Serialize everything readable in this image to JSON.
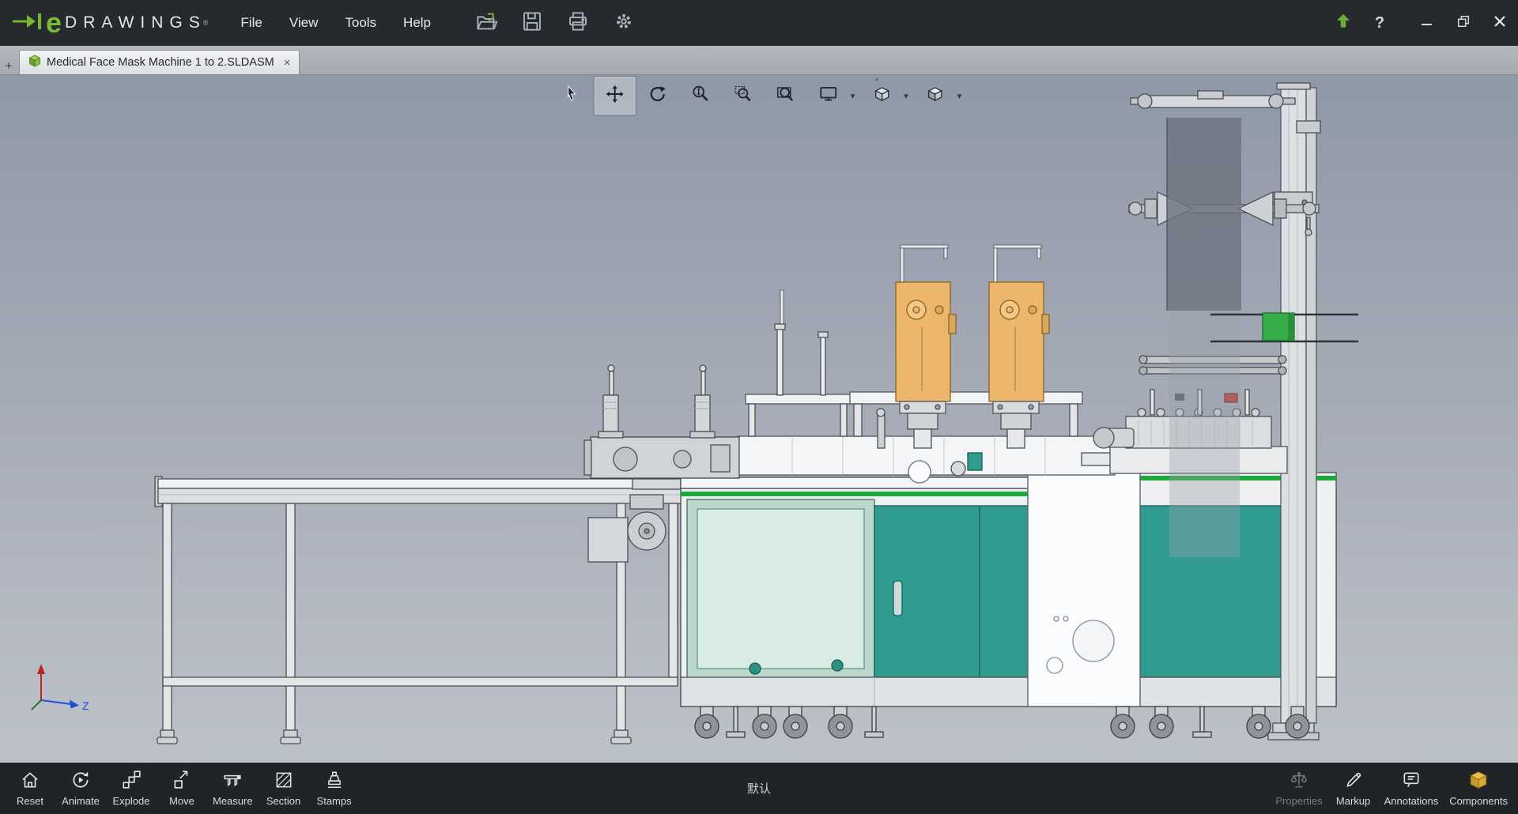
{
  "colors": {
    "brand_green": "#76b82a",
    "accent_green": "#1ea83b",
    "teal_panel": "#2f9c8f",
    "mint_panel": "#d9ece4",
    "orange_station": "#edb66d",
    "film_gray": "#707683",
    "titlebar_bg": "#26292e",
    "statusbar_bg": "#202327"
  },
  "titlebar": {
    "logo_e": "e",
    "logo_text": "DRAWINGS",
    "logo_mark": "®",
    "menus": [
      {
        "label": "File"
      },
      {
        "label": "View"
      },
      {
        "label": "Tools"
      },
      {
        "label": "Help"
      }
    ],
    "help_glyph": "?"
  },
  "tabbar": {
    "add_tab_glyph": "+",
    "tabs": [
      {
        "label": "Medical Face Mask Machine 1 to 2.SLDASM",
        "active": true,
        "close_glyph": "×"
      }
    ]
  },
  "view_toolbar": {
    "selected_tool": "pan",
    "tools": [
      "select",
      "pan",
      "rotate",
      "zoom",
      "zoom-area",
      "zoom-fit",
      "full-screen",
      "view-orientation",
      "display-style"
    ],
    "dropdown_glyph": "▾"
  },
  "viewport": {
    "triad_z_label": "Z"
  },
  "statusbar": {
    "left_buttons": [
      {
        "label": "Reset"
      },
      {
        "label": "Animate"
      },
      {
        "label": "Explode"
      },
      {
        "label": "Move"
      },
      {
        "label": "Measure"
      },
      {
        "label": "Section"
      },
      {
        "label": "Stamps"
      }
    ],
    "center_label": "默认",
    "right_buttons": [
      {
        "label": "Properties",
        "disabled": true
      },
      {
        "label": "Markup",
        "disabled": false
      },
      {
        "label": "Annotations",
        "disabled": false
      },
      {
        "label": "Components",
        "disabled": false
      }
    ]
  }
}
